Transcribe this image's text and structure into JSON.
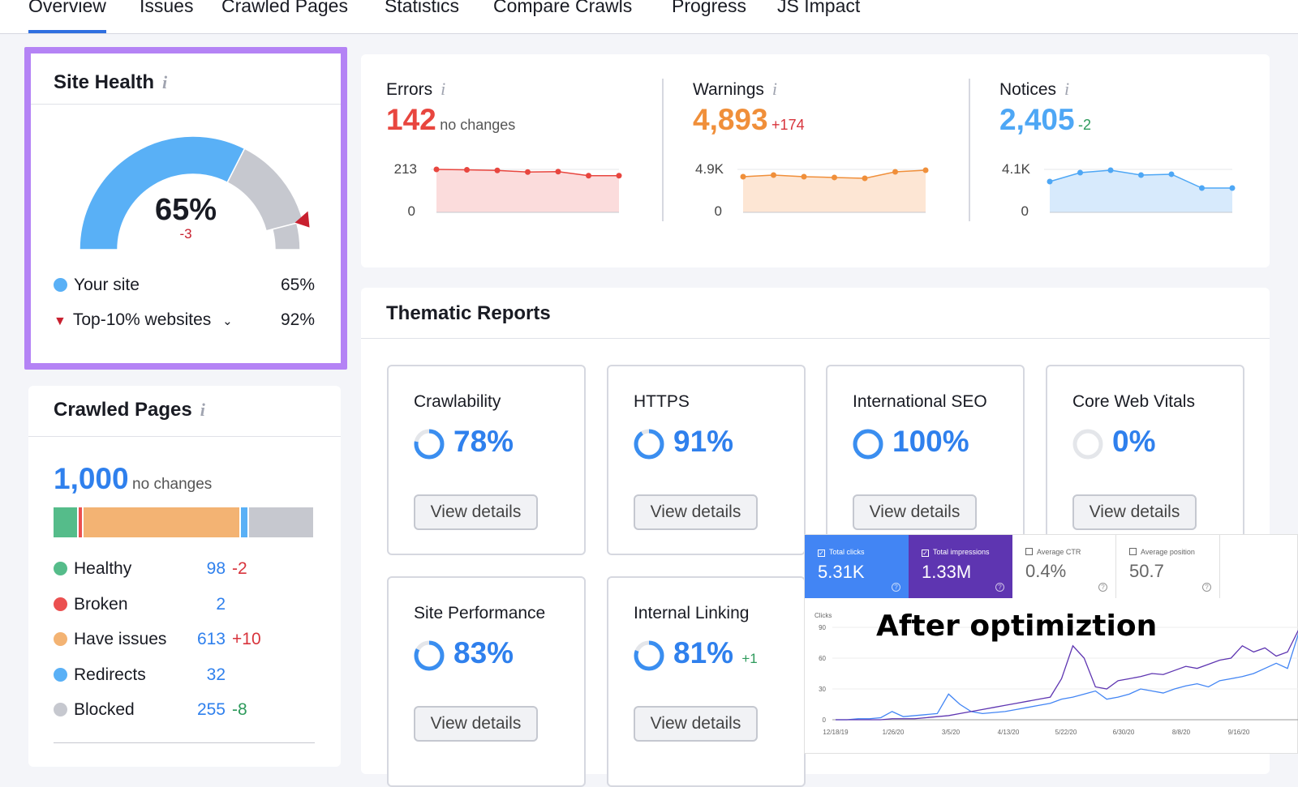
{
  "tabs": [
    "Overview",
    "Issues",
    "Crawled Pages",
    "Statistics",
    "Compare Crawls",
    "Progress",
    "JS Impact"
  ],
  "site_health": {
    "title": "Site Health",
    "value": "65%",
    "change": "-3",
    "value_pct": 65,
    "top10_pct": 92,
    "legend": [
      {
        "label": "Your site",
        "value": "65%"
      },
      {
        "label": "Top-10% websites",
        "value": "92%"
      }
    ],
    "colors": {
      "site": "#59b0f6",
      "rest": "#c6c8cf",
      "marker": "#c8202f",
      "border": "#b483f5"
    }
  },
  "crawled": {
    "title": "Crawled Pages",
    "total": "1,000",
    "change": "no changes",
    "items": [
      {
        "label": "Healthy",
        "value": "98",
        "delta": "-2",
        "count": 98,
        "color": "#55bc8a",
        "dcolor": "#d8343c"
      },
      {
        "label": "Broken",
        "value": "2",
        "delta": "",
        "count": 2,
        "color": "#eb5050",
        "dcolor": ""
      },
      {
        "label": "Have issues",
        "value": "613",
        "delta": "+10",
        "count": 613,
        "color": "#f3b373",
        "dcolor": "#d8343c"
      },
      {
        "label": "Redirects",
        "value": "32",
        "delta": "",
        "count": 32,
        "color": "#59b0f6",
        "dcolor": ""
      },
      {
        "label": "Blocked",
        "value": "255",
        "delta": "-8",
        "count": 255,
        "color": "#c6c8cf",
        "dcolor": "#2d9a5b"
      }
    ]
  },
  "issues": [
    {
      "title": "Errors",
      "value": "142",
      "change": "no changes",
      "ymax_label": "213",
      "ymin_label": "0",
      "ymax": 213,
      "color": "#e8463f",
      "fill": "#fbdcdc",
      "changecolor": "#555",
      "series": [
        213,
        211,
        208,
        200,
        202,
        182,
        182
      ]
    },
    {
      "title": "Warnings",
      "value": "4,893",
      "change": "+174",
      "ymax_label": "4.9K",
      "ymin_label": "0",
      "ymax": 4900,
      "color": "#f08f3a",
      "fill": "#fde6d4",
      "changecolor": "#d8343c",
      "series": [
        4070,
        4250,
        4070,
        3980,
        3880,
        4620,
        4810
      ]
    },
    {
      "title": "Notices",
      "value": "2,405",
      "change": "-2",
      "ymax_label": "4.1K",
      "ymin_label": "0",
      "ymax": 4100,
      "color": "#4ea7f5",
      "fill": "#d7eafc",
      "changecolor": "#2d9a5b",
      "series": [
        2940,
        3790,
        4020,
        3560,
        3640,
        2320,
        2320
      ]
    }
  ],
  "thematic": {
    "title": "Thematic Reports",
    "button": "View details",
    "cards": [
      {
        "title": "Crawlability",
        "value": "78%",
        "pct": 78,
        "delta": ""
      },
      {
        "title": "HTTPS",
        "value": "91%",
        "pct": 91,
        "delta": ""
      },
      {
        "title": "International SEO",
        "value": "100%",
        "pct": 100,
        "delta": ""
      },
      {
        "title": "Core Web Vitals",
        "value": "0%",
        "pct": 0,
        "delta": ""
      },
      {
        "title": "Site Performance",
        "value": "83%",
        "pct": 83,
        "delta": ""
      },
      {
        "title": "Internal Linking",
        "value": "81%",
        "pct": 81,
        "delta": "+1"
      }
    ]
  },
  "gsc": {
    "overlay_text": "After optimiztion",
    "metrics": [
      {
        "label": "Total clicks",
        "value": "5.31K",
        "checked": true,
        "bg": "#4285f4"
      },
      {
        "label": "Total impressions",
        "value": "1.33M",
        "checked": true,
        "bg": "#5e35b1"
      },
      {
        "label": "Average CTR",
        "value": "0.4%",
        "checked": false,
        "bg": "#fff"
      },
      {
        "label": "Average position",
        "value": "50.7",
        "checked": false,
        "bg": "#fff"
      }
    ],
    "chart_data": {
      "type": "line",
      "ylabel": "Clicks",
      "yticks": [
        0,
        30,
        60,
        90
      ],
      "ylim": [
        0,
        90
      ],
      "xticks": [
        "12/18/19",
        "1/26/20",
        "3/5/20",
        "4/13/20",
        "5/22/20",
        "6/30/20",
        "8/8/20",
        "9/16/20"
      ],
      "series": [
        {
          "color": "#4285f4",
          "values": [
            0,
            0,
            1,
            1,
            2,
            8,
            3,
            4,
            5,
            6,
            25,
            15,
            8,
            6,
            7,
            8,
            10,
            12,
            14,
            16,
            20,
            22,
            25,
            28,
            20,
            22,
            25,
            30,
            28,
            26,
            30,
            33,
            35,
            32,
            38,
            40,
            42,
            45,
            50,
            55,
            50,
            85
          ]
        },
        {
          "color": "#5e35b1",
          "values": [
            0,
            0,
            0,
            0,
            0,
            1,
            1,
            1,
            2,
            3,
            4,
            6,
            8,
            10,
            12,
            14,
            16,
            18,
            20,
            22,
            40,
            72,
            60,
            32,
            30,
            38,
            40,
            42,
            45,
            44,
            48,
            52,
            50,
            54,
            58,
            60,
            72,
            66,
            70,
            62,
            66,
            88
          ]
        }
      ]
    }
  }
}
